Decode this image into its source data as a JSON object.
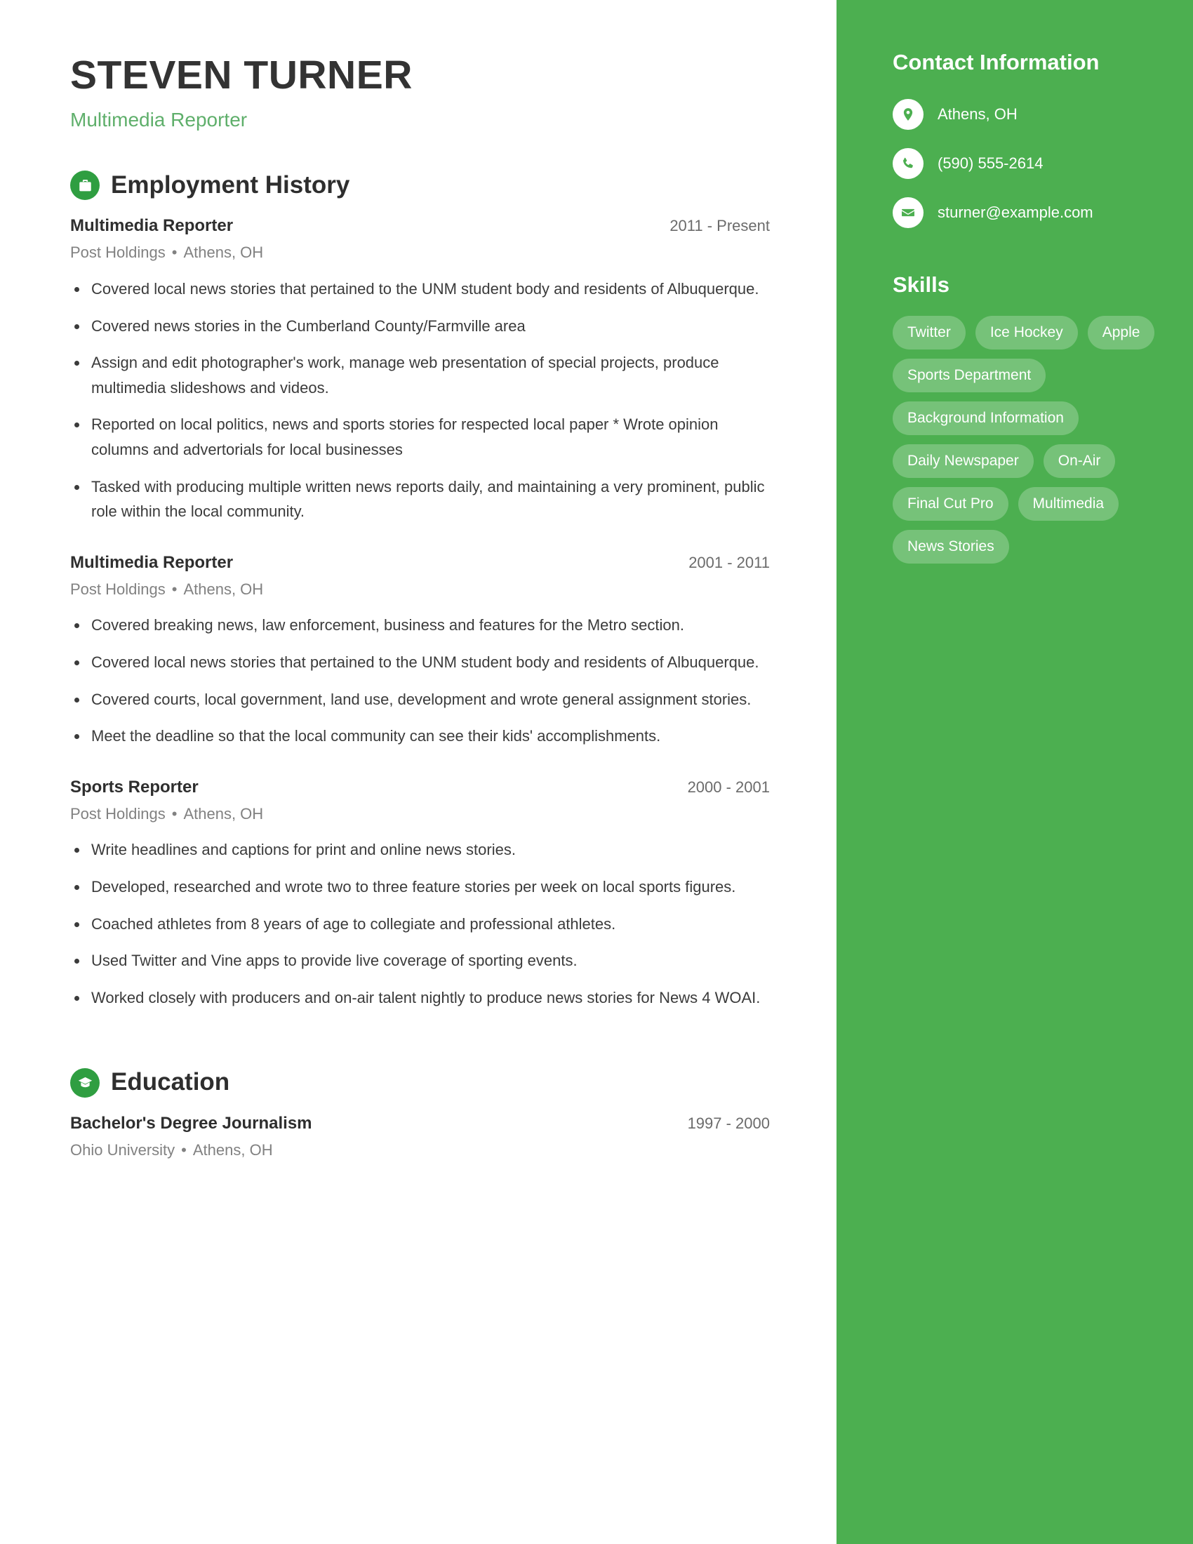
{
  "theme": {
    "sidebar_green": "#4CAF50",
    "icon_green": "#2F9E41",
    "accent_green": "#5FAF6B",
    "heading_dark": "#2e2e2e",
    "body_gray": "#3b3b3b",
    "muted_gray": "#818181"
  },
  "header": {
    "name": "STEVEN TURNER",
    "title": "Multimedia Reporter"
  },
  "sections": {
    "employment": {
      "icon": "briefcase-icon",
      "heading": "Employment History",
      "entries": [
        {
          "title": "Multimedia Reporter",
          "date": "2011 - Present",
          "company": "Post Holdings",
          "separator": "•",
          "location": "Athens, OH",
          "bullets": [
            "Covered local news stories that pertained to the UNM student body and residents of Albuquerque.",
            "Covered news stories in the Cumberland County/Farmville area",
            "Assign and edit photographer's work, manage web presentation of special projects, produce multimedia slideshows and videos.",
            "Reported on local politics, news and sports stories for respected local paper * Wrote opinion columns and advertorials for local businesses",
            "Tasked with producing multiple written news reports daily, and maintaining a very prominent, public role within the local community."
          ]
        },
        {
          "title": "Multimedia Reporter",
          "date": "2001 - 2011",
          "company": "Post Holdings",
          "separator": "•",
          "location": "Athens, OH",
          "bullets": [
            "Covered breaking news, law enforcement, business and features for the Metro section.",
            "Covered local news stories that pertained to the UNM student body and residents of Albuquerque.",
            "Covered courts, local government, land use, development and wrote general assignment stories.",
            "Meet the deadline so that the local community can see their kids' accomplishments."
          ]
        },
        {
          "title": "Sports Reporter",
          "date": "2000 - 2001",
          "company": "Post Holdings",
          "separator": "•",
          "location": "Athens, OH",
          "bullets": [
            "Write headlines and captions for print and online news stories.",
            "Developed, researched and wrote two to three feature stories per week on local sports figures.",
            "Coached athletes from 8 years of age to collegiate and professional athletes.",
            "Used Twitter and Vine apps to provide live coverage of sporting events.",
            "Worked closely with producers and on-air talent nightly to produce news stories for News 4 WOAI."
          ]
        }
      ]
    },
    "education": {
      "icon": "graduation-cap-icon",
      "heading": "Education",
      "entries": [
        {
          "title": "Bachelor's Degree Journalism",
          "date": "1997 - 2000",
          "school": "Ohio University",
          "separator": "•",
          "location": "Athens, OH"
        }
      ]
    }
  },
  "sidebar": {
    "contact": {
      "heading": "Contact Information",
      "items": [
        {
          "icon": "map-pin-icon",
          "value": "Athens, OH"
        },
        {
          "icon": "phone-icon",
          "value": "(590) 555-2614"
        },
        {
          "icon": "envelope-icon",
          "value": "sturner@example.com"
        }
      ]
    },
    "skills": {
      "heading": "Skills",
      "items": [
        "Twitter",
        "Ice Hockey",
        "Apple",
        "Sports Department",
        "Background Information",
        "Daily Newspaper",
        "On-Air",
        "Final Cut Pro",
        "Multimedia",
        "News Stories"
      ]
    }
  }
}
